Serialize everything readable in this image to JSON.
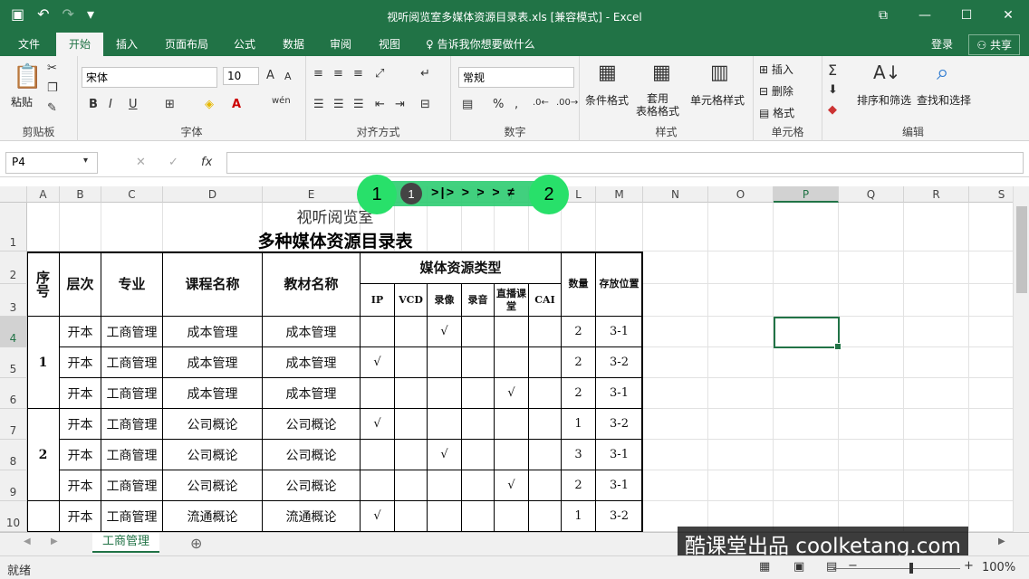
{
  "window": {
    "title": "视听阅览室多媒体资源目录表.xls  [兼容模式] - Excel",
    "minimize": "—",
    "restore": "☐",
    "close": "✕",
    "ribbon_display": "⧉"
  },
  "qat": {
    "save_icon": "save-icon",
    "undo": "↶",
    "redo": "↷",
    "customize": "▾"
  },
  "tabs": [
    "文件",
    "开始",
    "插入",
    "页面布局",
    "公式",
    "数据",
    "审阅",
    "视图"
  ],
  "tell_me": "告诉我你想要做什么",
  "account": {
    "login": "登录",
    "share": "共享"
  },
  "ribbon": {
    "clipboard": {
      "label": "剪贴板",
      "paste": "粘贴"
    },
    "font": {
      "label": "字体",
      "font_name": "宋体",
      "font_size": "10",
      "bold": "B",
      "italic": "I",
      "underline": "U",
      "grow": "A",
      "shrink": "A",
      "wen": "wén"
    },
    "alignment": {
      "label": "对齐方式"
    },
    "number": {
      "label": "数字",
      "format": "常规",
      "percent": "%",
      "comma": ","
    },
    "styles": {
      "label": "样式",
      "conditional": "条件格式",
      "table_format": "套用\n表格格式",
      "cell_styles": "单元格样式"
    },
    "cells": {
      "label": "单元格",
      "insert": "插入",
      "delete": "删除",
      "format": "格式"
    },
    "editing": {
      "label": "编辑",
      "sort_filter": "排序和筛选",
      "find_select": "查找和选择"
    }
  },
  "formula_bar": {
    "name_box": "P4",
    "cancel": "✕",
    "enter": "✓",
    "fx": "fx",
    "formula": ""
  },
  "columns": [
    "A",
    "B",
    "C",
    "D",
    "E",
    "F",
    "G",
    "H",
    "I",
    "J",
    "K",
    "L",
    "M",
    "N",
    "O",
    "P",
    "Q",
    "R",
    "S"
  ],
  "rows": [
    "1",
    "2",
    "3",
    "4",
    "5",
    "6",
    "7",
    "8",
    "9",
    "10"
  ],
  "sheet": {
    "title1": "视听阅览室",
    "title2": "多种媒体资源目录表",
    "headers": {
      "seq": "序号",
      "level": "层次",
      "major": "专业",
      "course": "课程名称",
      "textbook": "教材名称",
      "media_type": "媒体资源类型",
      "qty": "数量",
      "location": "存放位置"
    },
    "media": [
      "IP",
      "VCD",
      "录像",
      "录音",
      "直播课堂",
      "CAI"
    ],
    "check": "√",
    "groups": [
      {
        "seq": "1",
        "rows": [
          {
            "level": "开本",
            "major": "工商管理",
            "course": "成本管理",
            "textbook": "成本管理",
            "media": [
              false,
              false,
              true,
              false,
              false,
              false
            ],
            "qty": "2",
            "location": "3-1"
          },
          {
            "level": "开本",
            "major": "工商管理",
            "course": "成本管理",
            "textbook": "成本管理",
            "media": [
              true,
              false,
              false,
              false,
              false,
              false
            ],
            "qty": "2",
            "location": "3-2"
          },
          {
            "level": "开本",
            "major": "工商管理",
            "course": "成本管理",
            "textbook": "成本管理",
            "media": [
              false,
              false,
              false,
              false,
              true,
              false
            ],
            "qty": "2",
            "location": "3-1"
          }
        ]
      },
      {
        "seq": "2",
        "rows": [
          {
            "level": "开本",
            "major": "工商管理",
            "course": "公司概论",
            "textbook": "公司概论",
            "media": [
              true,
              false,
              false,
              false,
              false,
              false
            ],
            "qty": "1",
            "location": "3-2"
          },
          {
            "level": "开本",
            "major": "工商管理",
            "course": "公司概论",
            "textbook": "公司概论",
            "media": [
              false,
              false,
              true,
              false,
              false,
              false
            ],
            "qty": "3",
            "location": "3-1"
          },
          {
            "level": "开本",
            "major": "工商管理",
            "course": "公司概论",
            "textbook": "公司概论",
            "media": [
              false,
              false,
              false,
              false,
              true,
              false
            ],
            "qty": "2",
            "location": "3-1"
          }
        ]
      },
      {
        "seq": "",
        "rows": [
          {
            "level": "开本",
            "major": "工商管理",
            "course": "流通概论",
            "textbook": "流通概论",
            "media": [
              true,
              false,
              false,
              false,
              false,
              false
            ],
            "qty": "1",
            "location": "3-2"
          }
        ]
      }
    ]
  },
  "sheet_tabs": {
    "active": "工商管理",
    "add": "⊕"
  },
  "status": {
    "ready": "就绪",
    "zoom": "100%",
    "minus": "−",
    "plus": "+"
  },
  "overlay": {
    "step1": "1",
    "step_small": "1",
    "step2": "2",
    "arrows": ">|> > > >  ≠"
  },
  "watermark": "酷课堂出品 coolketang.com",
  "colors": {
    "accent": "#217346",
    "overlay_green": "#28e06a"
  }
}
